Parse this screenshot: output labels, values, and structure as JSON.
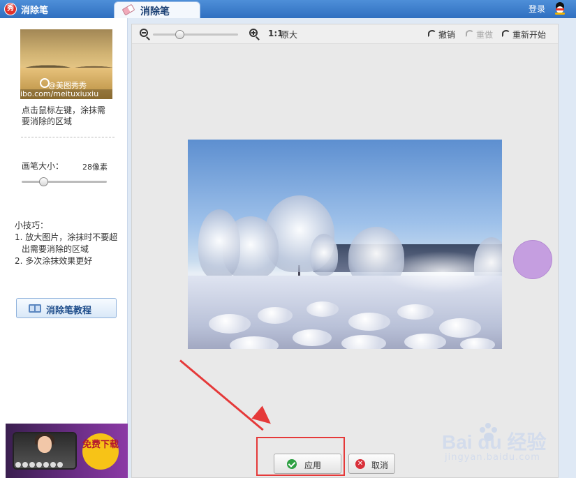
{
  "window": {
    "app_title": "消除笔",
    "logo_char": "秀",
    "tab_label": "消除笔",
    "login": "登录"
  },
  "left_panel": {
    "thumbnail_watermark_handle": "@美图秀秀",
    "thumbnail_watermark_url": "ibo.com/meituxiuxiu",
    "hint": "点击鼠标左键，涂抹需要消除的区域",
    "brush_size_label": "画笔大小：",
    "brush_size_value": "28像素",
    "brush_slider_fraction": 0.25,
    "tips_title": "小技巧：",
    "tips": [
      "1. 放大图片，涂抹时不要超出需要消除的区域",
      "2. 多次涂抹效果更好"
    ],
    "tutorial_button": "消除笔教程",
    "ad_badge": "免费下载"
  },
  "toolbar": {
    "zoom_slider_fraction": 0.31,
    "ratio": "1:1",
    "ratio_label": "原大",
    "undo": "撤销",
    "redo": "重做",
    "restart": "重新开始"
  },
  "footer": {
    "apply": "应用",
    "cancel": "取消"
  },
  "watermark": {
    "brand": "Bai du 经验",
    "url": "jingyan.baidu.com"
  },
  "colors": {
    "titlebar": "#2f6fc0",
    "annotation": "#e53939",
    "brush_cursor": "#c59ee0"
  }
}
